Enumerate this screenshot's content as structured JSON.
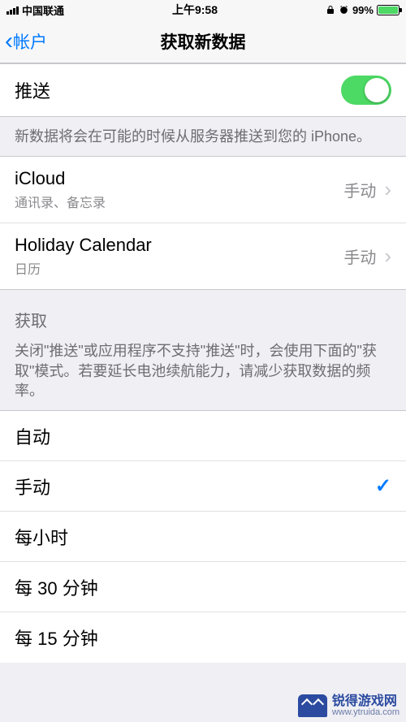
{
  "status": {
    "carrier": "中国联通",
    "time": "上午9:58",
    "battery_pct": "99%"
  },
  "nav": {
    "back": "帐户",
    "title": "获取新数据"
  },
  "push": {
    "label": "推送",
    "enabled": true,
    "footer": "新数据将会在可能的时候从服务器推送到您的 iPhone。"
  },
  "accounts": [
    {
      "name": "iCloud",
      "detail": "通讯录、备忘录",
      "mode": "手动"
    },
    {
      "name": "Holiday Calendar",
      "detail": "日历",
      "mode": "手动"
    }
  ],
  "fetch": {
    "header": "获取",
    "footer": "关闭\"推送\"或应用程序不支持\"推送\"时，会使用下面的\"获取\"模式。若要延长电池续航能力，请减少获取数据的频率。",
    "options": [
      {
        "label": "自动",
        "selected": false
      },
      {
        "label": "手动",
        "selected": true
      },
      {
        "label": "每小时",
        "selected": false
      },
      {
        "label": "每 30 分钟",
        "selected": false
      },
      {
        "label": "每 15 分钟",
        "selected": false
      }
    ]
  },
  "watermark": {
    "name": "锐得游戏网",
    "url": "www.ytruida.com"
  }
}
